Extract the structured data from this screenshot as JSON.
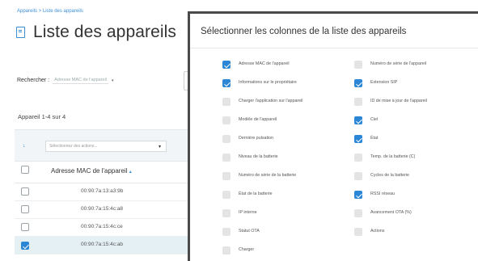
{
  "breadcrumb": "Appareils > Liste des appareils",
  "page_title": "Liste des appareils",
  "search": {
    "label": "Rechercher :",
    "field": "Adresse MAC de l'appareil",
    "caret": "▾"
  },
  "count_text": "Appareil 1-4 sur 4",
  "bulk_actions": {
    "placeholder": "Sélectionnez des actions...",
    "caret": "▾",
    "arrow": "↓"
  },
  "table": {
    "column_header": "Adresse MAC de l'appareil",
    "sort_indicator": "▴",
    "rows": [
      {
        "mac": "00:90:7a:13:a3:9b",
        "checked": false
      },
      {
        "mac": "00:90:7a:15:4c:a8",
        "checked": false
      },
      {
        "mac": "00:90:7a:15:4c:ce",
        "checked": false
      },
      {
        "mac": "00:90:7a:15:4c:ab",
        "checked": true
      }
    ]
  },
  "modal": {
    "title": "Sélectionner les colonnes de la liste des appareils",
    "left_column": [
      {
        "label": "Adresse MAC de l'appareil",
        "state": "on"
      },
      {
        "label": "Informations sur le propriétaire",
        "state": "on"
      },
      {
        "label": "Charger l'application sur l'appareil",
        "state": "off"
      },
      {
        "label": "Modèle de l'appareil",
        "state": "off"
      },
      {
        "label": "Dernière pulsation",
        "state": "off"
      },
      {
        "label": "Niveau de la batterie",
        "state": "off"
      },
      {
        "label": "Numéro de série de la batterie",
        "state": "off"
      },
      {
        "label": "État de la batterie",
        "state": "off"
      },
      {
        "label": "IP interne",
        "state": "off"
      },
      {
        "label": "Statut OTA",
        "state": "off"
      },
      {
        "label": "Charger",
        "state": "off"
      }
    ],
    "right_column": [
      {
        "label": "Numéro de série de l'appareil",
        "state": "grey"
      },
      {
        "label": "Extension SIP",
        "state": "on"
      },
      {
        "label": "ID de mise à jour de l'appareil",
        "state": "off"
      },
      {
        "label": "Ciel",
        "state": "on"
      },
      {
        "label": "État",
        "state": "on"
      },
      {
        "label": "Temp. de la batterie (C)",
        "state": "off"
      },
      {
        "label": "Cycles de la batterie",
        "state": "off"
      },
      {
        "label": "RSSI réseau",
        "state": "on"
      },
      {
        "label": "Avancement OTA (%)",
        "state": "off"
      },
      {
        "label": "Actions",
        "state": "grey"
      }
    ]
  },
  "colors": {
    "accent": "#2b86d6",
    "link": "#3b8fd6",
    "selected_row": "#e5f0f5",
    "modal_border": "#4a4a4a"
  }
}
